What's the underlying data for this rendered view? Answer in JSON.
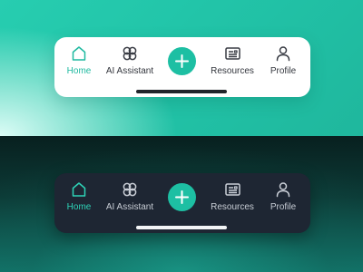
{
  "nav": {
    "items": [
      {
        "label": "Home",
        "icon": "home-icon",
        "active": true
      },
      {
        "label": "AI Assistant",
        "icon": "ai-assistant-icon",
        "active": false
      },
      {
        "label": "Resources",
        "icon": "resources-icon",
        "active": false
      },
      {
        "label": "Profile",
        "icon": "profile-icon",
        "active": false
      }
    ],
    "add_icon": "plus-icon"
  },
  "colors": {
    "accent": "#1dbfa3",
    "light_bar": "#ffffff",
    "dark_bar": "#1e2633"
  }
}
